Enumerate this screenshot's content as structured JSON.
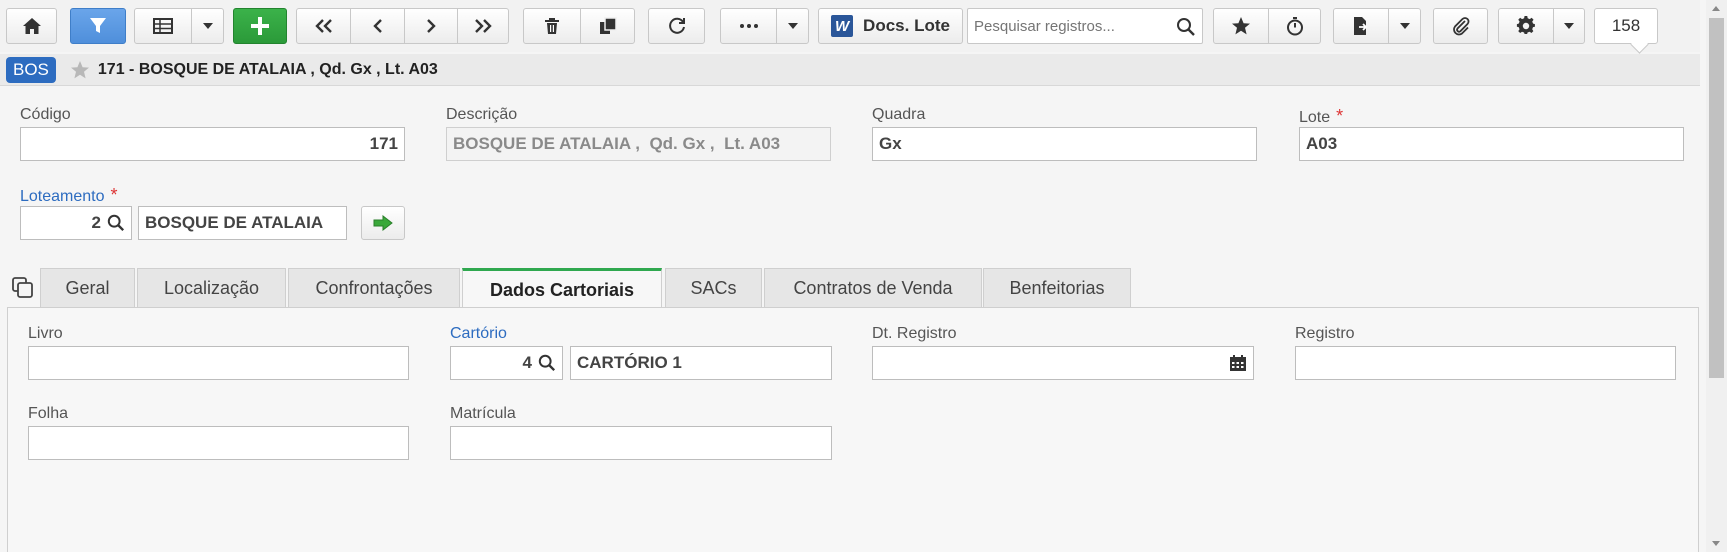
{
  "toolbar": {
    "docs_label": "Docs. Lote",
    "search_placeholder": "Pesquisar registros...",
    "record_count": "158"
  },
  "record": {
    "badge": "BOS",
    "title": "171 - BOSQUE DE ATALAIA , Qd. Gx , Lt. A03"
  },
  "form": {
    "codigo_label": "Código",
    "codigo_value": "171",
    "descricao_label": "Descrição",
    "descricao_value": "BOSQUE DE ATALAIA ,  Qd. Gx ,  Lt. A03",
    "quadra_label": "Quadra",
    "quadra_value": "Gx",
    "lote_label": "Lote",
    "lote_value": "A03",
    "loteamento_label": "Loteamento",
    "loteamento_code": "2",
    "loteamento_name": "BOSQUE DE ATALAIA",
    "required_mark": "*"
  },
  "tabs": [
    {
      "label": "Geral"
    },
    {
      "label": "Localização"
    },
    {
      "label": "Confrontações"
    },
    {
      "label": "Dados Cartoriais"
    },
    {
      "label": "SACs"
    },
    {
      "label": "Contratos de Venda"
    },
    {
      "label": "Benfeitorias"
    }
  ],
  "active_tab": "Dados Cartoriais",
  "cartorial": {
    "livro_label": "Livro",
    "livro_value": "",
    "cartorio_label": "Cartório",
    "cartorio_code": "4",
    "cartorio_name": "CARTÓRIO 1",
    "dt_registro_label": "Dt. Registro",
    "dt_registro_value": "",
    "registro_label": "Registro",
    "registro_value": "",
    "folha_label": "Folha",
    "folha_value": "",
    "matricula_label": "Matrícula",
    "matricula_value": ""
  },
  "colors": {
    "accent_blue": "#4f8fdb",
    "add_green": "#2b9a39",
    "active_tab_border": "#2fa84f",
    "badge_blue": "#2d6cc0",
    "required_red": "#dd3333"
  }
}
